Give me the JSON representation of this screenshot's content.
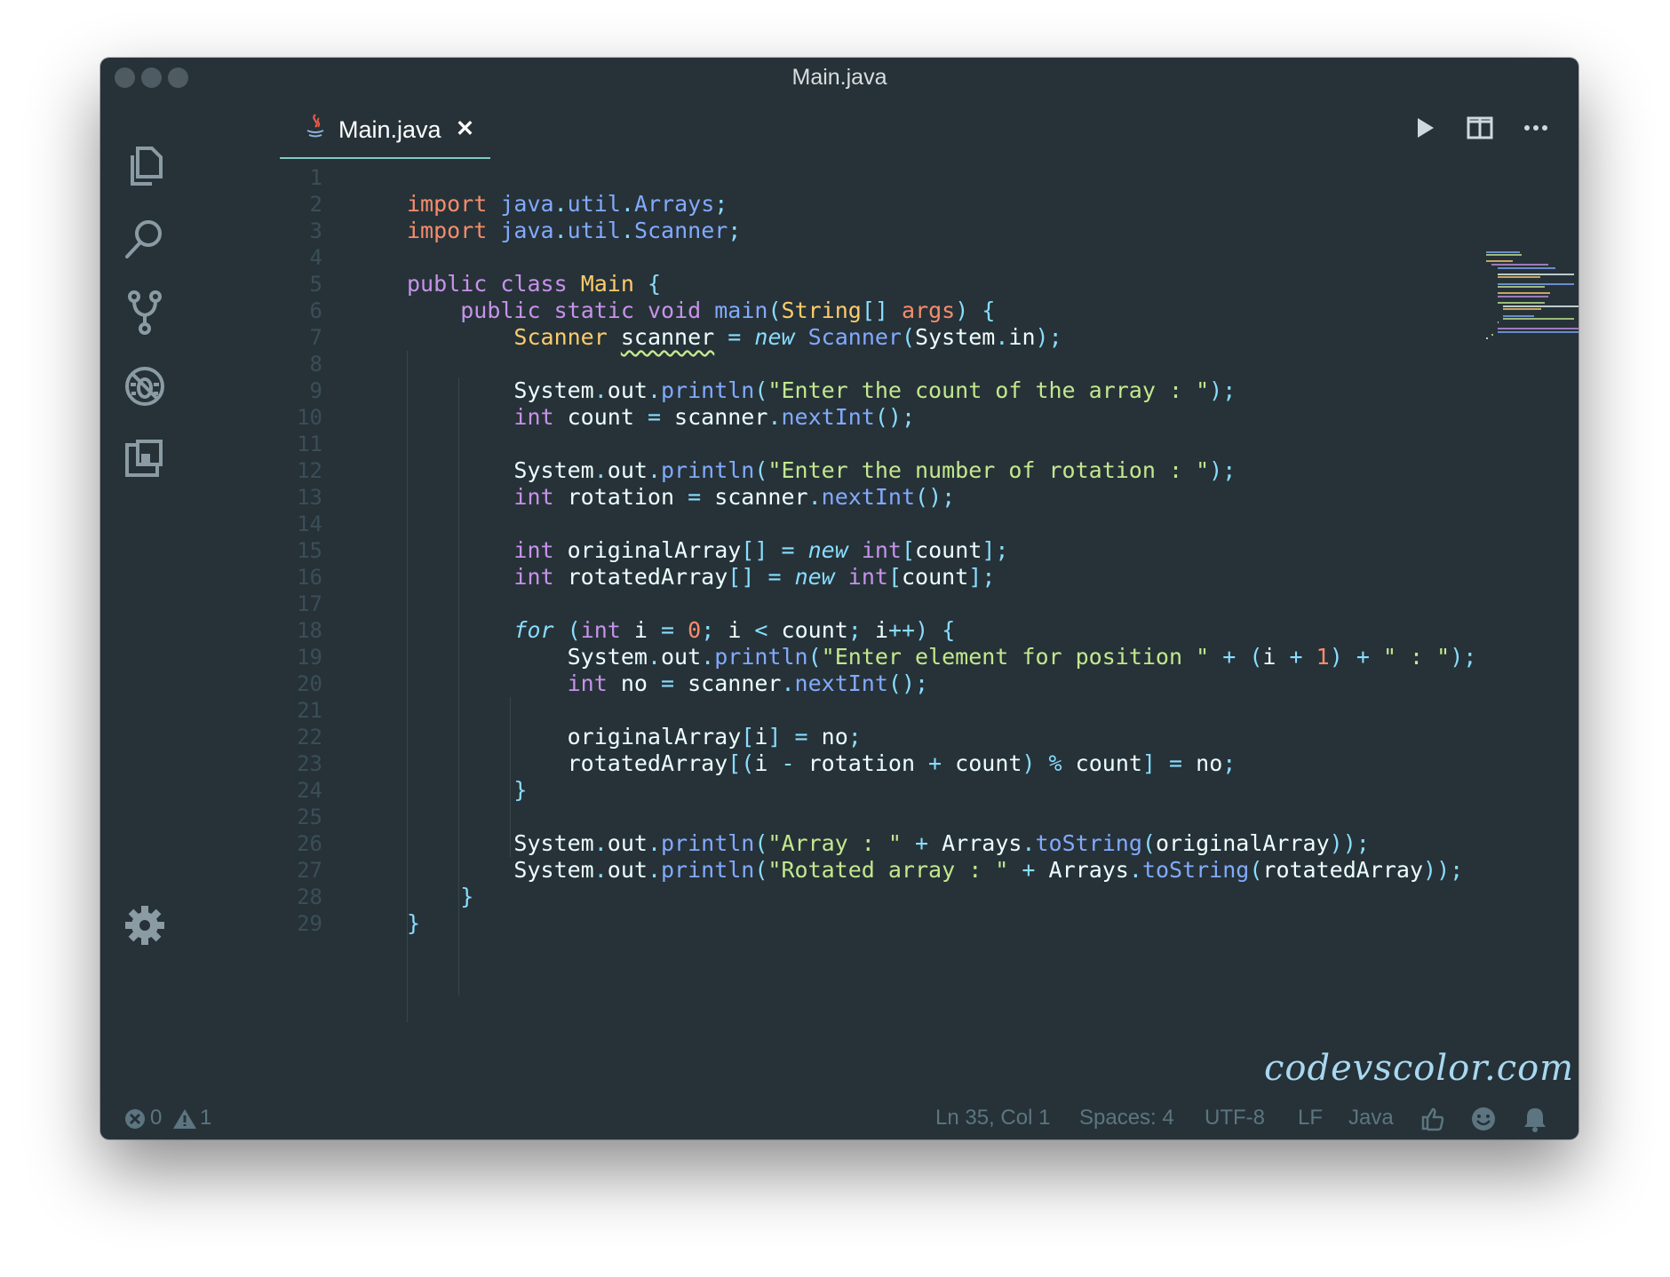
{
  "window": {
    "title": "Main.java"
  },
  "activity_bar": {
    "items": [
      "explorer-icon",
      "search-icon",
      "source-control-icon",
      "debug-icon",
      "extensions-icon"
    ],
    "bottom": "settings-gear-icon"
  },
  "tab": {
    "label": "Main.java",
    "close": "✕",
    "icon": "java-icon"
  },
  "tab_actions": [
    "run-icon",
    "split-editor-icon",
    "more-icon"
  ],
  "line_numbers": [
    "1",
    "2",
    "3",
    "4",
    "5",
    "6",
    "7",
    "8",
    "9",
    "10",
    "11",
    "12",
    "13",
    "14",
    "15",
    "16",
    "17",
    "18",
    "19",
    "20",
    "21",
    "22",
    "23",
    "24",
    "25",
    "26",
    "27",
    "28",
    "29"
  ],
  "code_lines": [
    "",
    "import java.util.Arrays;",
    "import java.util.Scanner;",
    "",
    "public class Main {",
    "    public static void main(String[] args) {",
    "        Scanner scanner = new Scanner(System.in);",
    "",
    "        System.out.println(\"Enter the count of the array : \");",
    "        int count = scanner.nextInt();",
    "",
    "        System.out.println(\"Enter the number of rotation : \");",
    "        int rotation = scanner.nextInt();",
    "",
    "        int originalArray[] = new int[count];",
    "        int rotatedArray[] = new int[count];",
    "",
    "        for (int i = 0; i < count; i++) {",
    "            System.out.println(\"Enter element for position \" + (i + 1) + \" : \");",
    "            int no = scanner.nextInt();",
    "",
    "            originalArray[i] = no;",
    "            rotatedArray[(i - rotation + count) % count] = no;",
    "        }",
    "",
    "        System.out.println(\"Array : \" + Arrays.toString(originalArray));",
    "        System.out.println(\"Rotated array : \" + Arrays.toString(rotatedArray));",
    "    }",
    "}"
  ],
  "watermark": "codevscolor.com",
  "status": {
    "errors": "0",
    "warnings": "1",
    "position": "Ln 35, Col 1",
    "spaces": "Spaces: 4",
    "encoding": "UTF-8",
    "eol": "LF",
    "language": "Java",
    "icons": [
      "thumbs-up-icon",
      "smiley-icon",
      "bell-icon"
    ]
  },
  "colors": {
    "background": "#263238",
    "keyword": "#c792ea",
    "import": "#f78c6c",
    "type": "#ffcb6b",
    "function": "#82aaff",
    "string": "#c3e88d",
    "operator": "#89ddff",
    "accent": "#80cbc4"
  }
}
